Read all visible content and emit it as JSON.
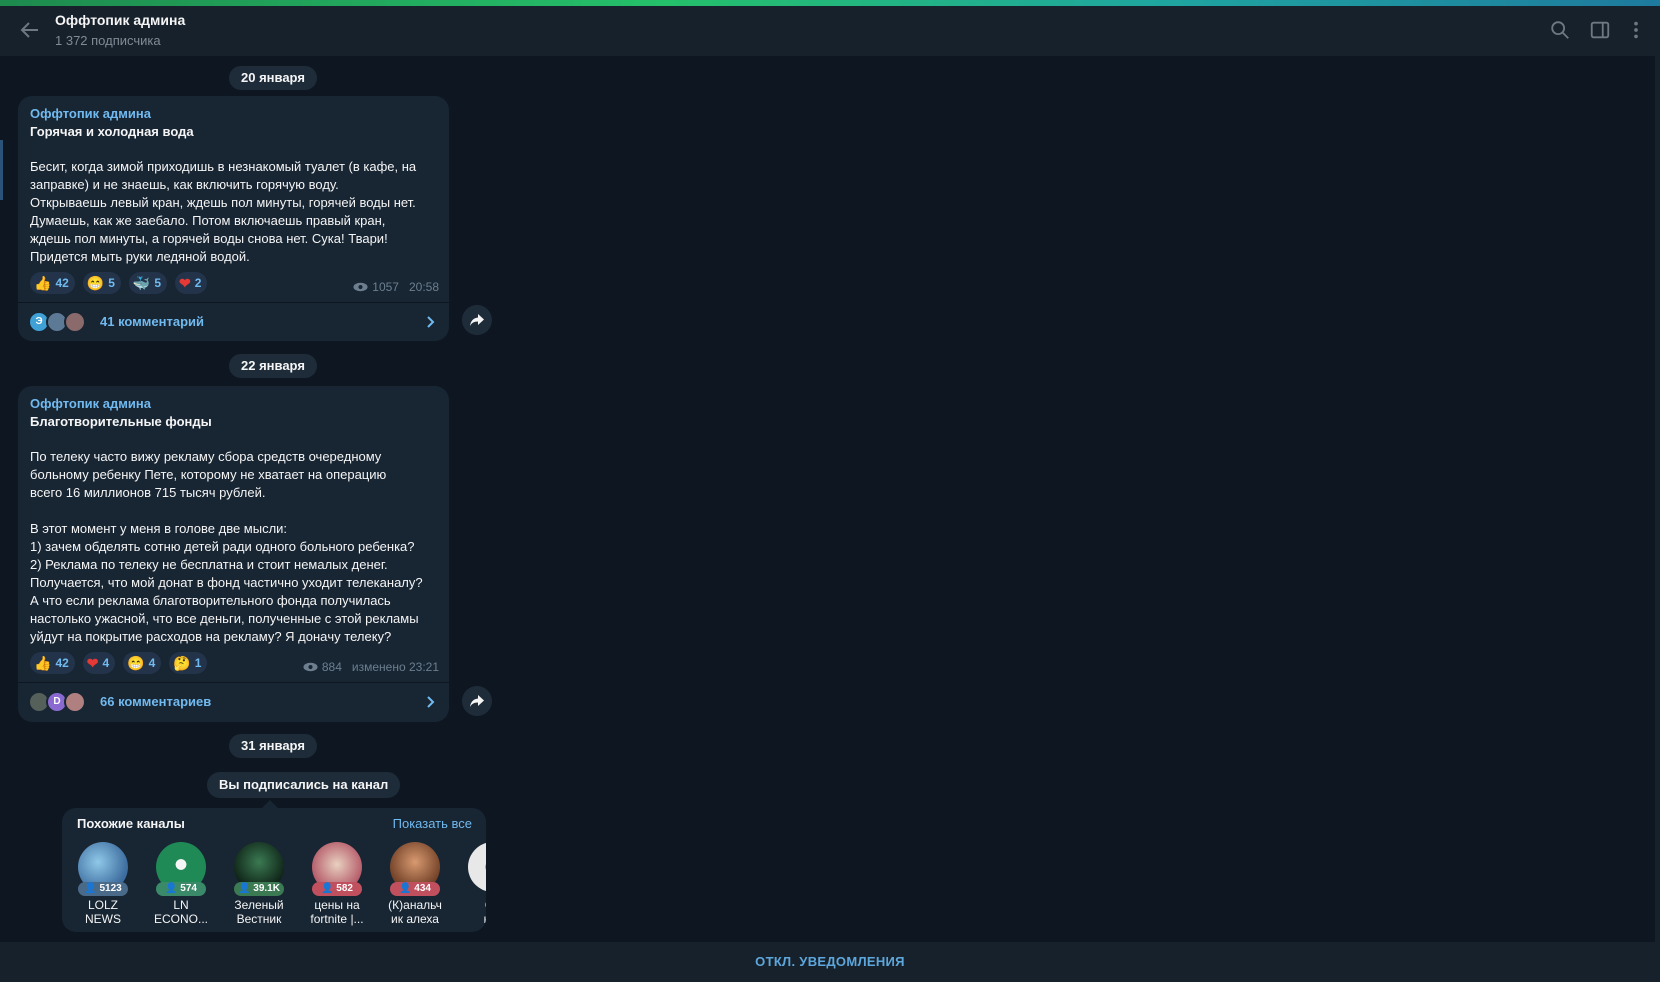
{
  "header": {
    "title": "Оффтопик админа",
    "subscribers": "1 372 подписчика",
    "icons": [
      "back-arrow-icon",
      "search-icon",
      "sidebar-icon",
      "more-vert-icon"
    ]
  },
  "dates": [
    "20 января",
    "22 января",
    "31 января"
  ],
  "posts": [
    {
      "author": "Оффтопик админа",
      "heading": "Горячая и холодная вода",
      "text": "Бесит, когда зимой приходишь в незнакомый туалет (в кафе, на\nзаправке) и не знаешь, как включить горячую воду.\nОткрываешь левый кран, ждешь пол минуты, горячей воды нет.\nДумаешь, как же заебало. Потом включаешь правый кран,\nждешь пол минуты, а горячей воды снова нет. Сука! Твари!\nПридется мыть руки ледяной водой.",
      "reactions": [
        {
          "emoji": "👍",
          "count": "42"
        },
        {
          "emoji": "😁",
          "count": "5"
        },
        {
          "emoji": "🐳",
          "count": "5"
        },
        {
          "emoji": "❤",
          "count": "2"
        }
      ],
      "views": "1057",
      "time": "20:58",
      "comments": "41 комментарий",
      "avatar_letter": "Э"
    },
    {
      "author": "Оффтопик админа",
      "heading": "Благотворительные фонды",
      "text": "По телеку часто вижу рекламу сбора средств очередному\nбольному ребенку Пете, которому не хватает на операцию\nвсего 16 миллионов 715 тысяч рублей.\n\nВ этот момент у меня в голове две мысли:\n1) зачем обделять сотню детей ради одного больного ребенка?\n2) Реклама по телеку не бесплатна и стоит немалых денег.\nПолучается, что мой донат в фонд частично уходит телеканалу?\nА что если реклама благотворительного фонда получилась\nнастолько ужасной, что все деньги, полученные с этой рекламы\nуйдут на покрытие расходов на рекламу? Я донaчу телеку?",
      "reactions": [
        {
          "emoji": "👍",
          "count": "42"
        },
        {
          "emoji": "❤",
          "count": "4"
        },
        {
          "emoji": "😁",
          "count": "4"
        },
        {
          "emoji": "🤔",
          "count": "1"
        }
      ],
      "views": "884",
      "time": "изменено 23:21",
      "comments": "66 комментариев",
      "avatar_letter": "D"
    }
  ],
  "service_message": "Вы подписались на канал",
  "similar": {
    "title": "Похожие каналы",
    "show_all": "Показать все",
    "channels": [
      {
        "name": "LOLZ\nNEWS",
        "count": "5123",
        "color": "#3d6c9e",
        "badge": "#4a6a8a"
      },
      {
        "name": "LN\nECONO...",
        "count": "574",
        "color": "#1f8a55",
        "badge": "#3a8a6a"
      },
      {
        "name": "Зеленый\nВестник",
        "count": "39.1K",
        "color": "#1b3b28",
        "badge": "#3b7a52"
      },
      {
        "name": "цены на\nfortnite |...",
        "count": "582",
        "color": "#b55c6a",
        "badge": "#c0505e"
      },
      {
        "name": "(К)анальч\nик алеха",
        "count": "434",
        "color": "#9a5e3c",
        "badge": "#c0505e"
      },
      {
        "name": "Об\nкри",
        "count": "",
        "color": "#d8d8d8",
        "badge": "#7a7a7a"
      }
    ]
  },
  "footer": {
    "mute_label": "ОТКЛ. УВЕДОМЛЕНИЯ"
  },
  "colors": {
    "accent": "#71baf0",
    "bubble": "#182533",
    "background": "#0e1621"
  }
}
